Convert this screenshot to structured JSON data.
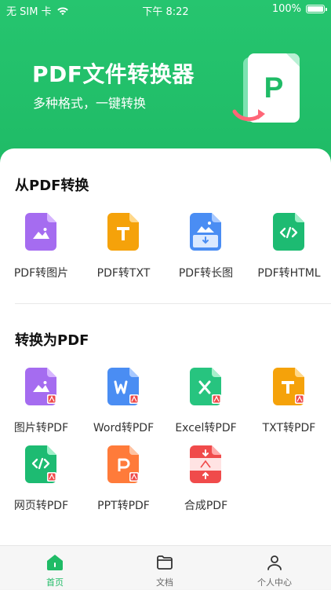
{
  "status_bar": {
    "carrier": "无 SIM 卡",
    "time": "下午 8:22",
    "battery": "100%"
  },
  "hero": {
    "title": "PDF文件转换器",
    "subtitle": "多种格式，一键转换",
    "illustration_letter": "P"
  },
  "sections": {
    "from_pdf": {
      "title": "从PDF转换",
      "items": [
        {
          "label": "PDF转图片",
          "icon": "image-file-icon",
          "color": "#a56cf0"
        },
        {
          "label": "PDF转TXT",
          "icon": "txt-file-icon",
          "color": "#f5a20a"
        },
        {
          "label": "PDF转长图",
          "icon": "long-image-file-icon",
          "color": "#4a8df3"
        },
        {
          "label": "PDF转HTML",
          "icon": "html-file-icon",
          "color": "#1dbb72"
        }
      ]
    },
    "to_pdf": {
      "title": "转换为PDF",
      "items": [
        {
          "label": "图片转PDF",
          "icon": "image-to-pdf-icon",
          "color": "#a56cf0"
        },
        {
          "label": "Word转PDF",
          "icon": "word-to-pdf-icon",
          "color": "#4a8df3"
        },
        {
          "label": "Excel转PDF",
          "icon": "excel-to-pdf-icon",
          "color": "#27c47f"
        },
        {
          "label": "TXT转PDF",
          "icon": "txt-to-pdf-icon",
          "color": "#f5a20a"
        },
        {
          "label": "网页转PDF",
          "icon": "webpage-to-pdf-icon",
          "color": "#1dbb72"
        },
        {
          "label": "PPT转PDF",
          "icon": "ppt-to-pdf-icon",
          "color": "#ff7b3a"
        },
        {
          "label": "合成PDF",
          "icon": "merge-pdf-icon",
          "color": "#f04b4b"
        }
      ]
    }
  },
  "tabbar": {
    "items": [
      {
        "label": "首页",
        "icon": "home-icon"
      },
      {
        "label": "文档",
        "icon": "folder-icon"
      },
      {
        "label": "个人中心",
        "icon": "user-icon"
      }
    ],
    "active_index": 0,
    "accent": "#1fbb66"
  }
}
